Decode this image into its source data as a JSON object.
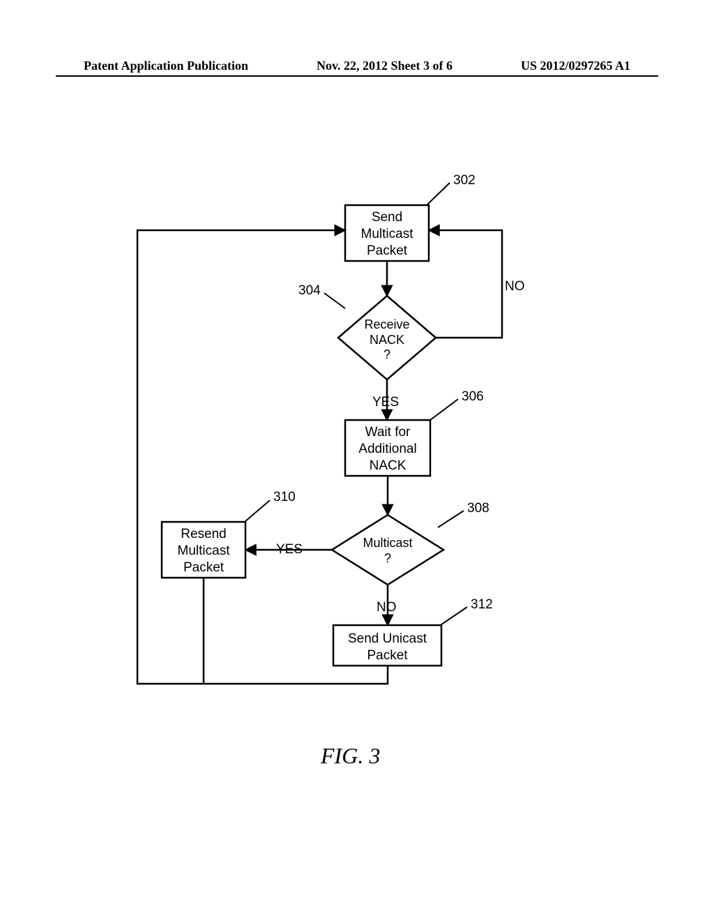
{
  "header": {
    "left": "Patent Application Publication",
    "center": "Nov. 22, 2012  Sheet 3 of 6",
    "right": "US 2012/0297265 A1"
  },
  "figure_caption": "FIG. 3",
  "refs": {
    "r302": "302",
    "r304": "304",
    "r306": "306",
    "r308": "308",
    "r310": "310",
    "r312": "312"
  },
  "nodes": {
    "n302": "Send\nMulticast\nPacket",
    "n304": "Receive\nNACK\n?",
    "n306": "Wait for\nAdditional\nNACK",
    "n308": "Multicast\n?",
    "n310": "Resend\nMulticast\nPacket",
    "n312": "Send Unicast\nPacket"
  },
  "edges": {
    "no1": "NO",
    "yes1": "YES",
    "yes2": "YES",
    "no2": "NO"
  }
}
